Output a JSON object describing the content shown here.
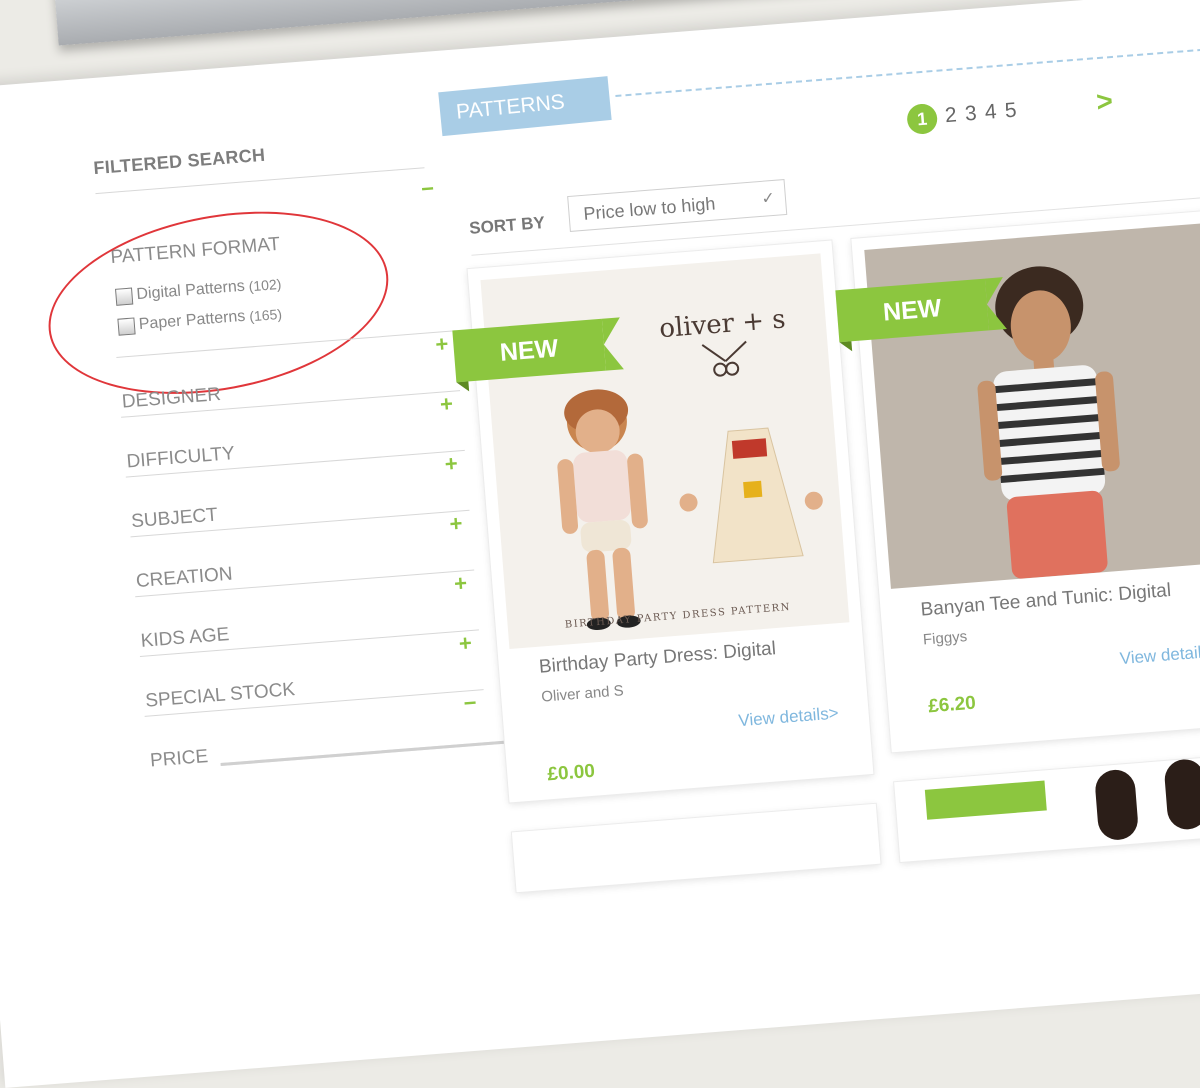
{
  "sidebar": {
    "title": "FILTERED SEARCH",
    "facets": [
      {
        "label": "PATTERN FORMAT",
        "toggle": "−"
      },
      {
        "label": "DESIGNER",
        "toggle": "+"
      },
      {
        "label": "DIFFICULTY",
        "toggle": "+"
      },
      {
        "label": "SUBJECT",
        "toggle": "+"
      },
      {
        "label": "CREATION",
        "toggle": "+"
      },
      {
        "label": "KIDS AGE",
        "toggle": "+"
      },
      {
        "label": "SPECIAL STOCK",
        "toggle": "+"
      },
      {
        "label": "PRICE",
        "toggle": "−"
      }
    ],
    "pattern_format_options": [
      {
        "label": "Digital Patterns",
        "count": "(102)",
        "checked": false
      },
      {
        "label": "Paper Patterns",
        "count": "(165)",
        "checked": false
      }
    ],
    "price_slider_position": 1.0
  },
  "section_tab": "PATTERNS",
  "pagination": {
    "pages": [
      "1",
      "2",
      "3",
      "4",
      "5"
    ],
    "current": "1",
    "next": ">"
  },
  "sort": {
    "label": "SORT BY",
    "value": "Price low to high"
  },
  "products": [
    {
      "badge": "NEW",
      "brand": "oliver + s",
      "caption": "BIRTHDAY PARTY DRESS PATTERN",
      "title": "Birthday Party Dress: Digital",
      "maker": "Oliver and S",
      "view": "View details>",
      "price": "£0.00"
    },
    {
      "badge": "NEW",
      "title": "Banyan Tee and Tunic: Digital",
      "maker": "Figgys",
      "view": "View details>",
      "price": "£6.20"
    }
  ],
  "colors": {
    "accent": "#8cc63f",
    "tab": "#a9cde6",
    "link": "#7fb7de",
    "annotation": "#e0363a"
  }
}
